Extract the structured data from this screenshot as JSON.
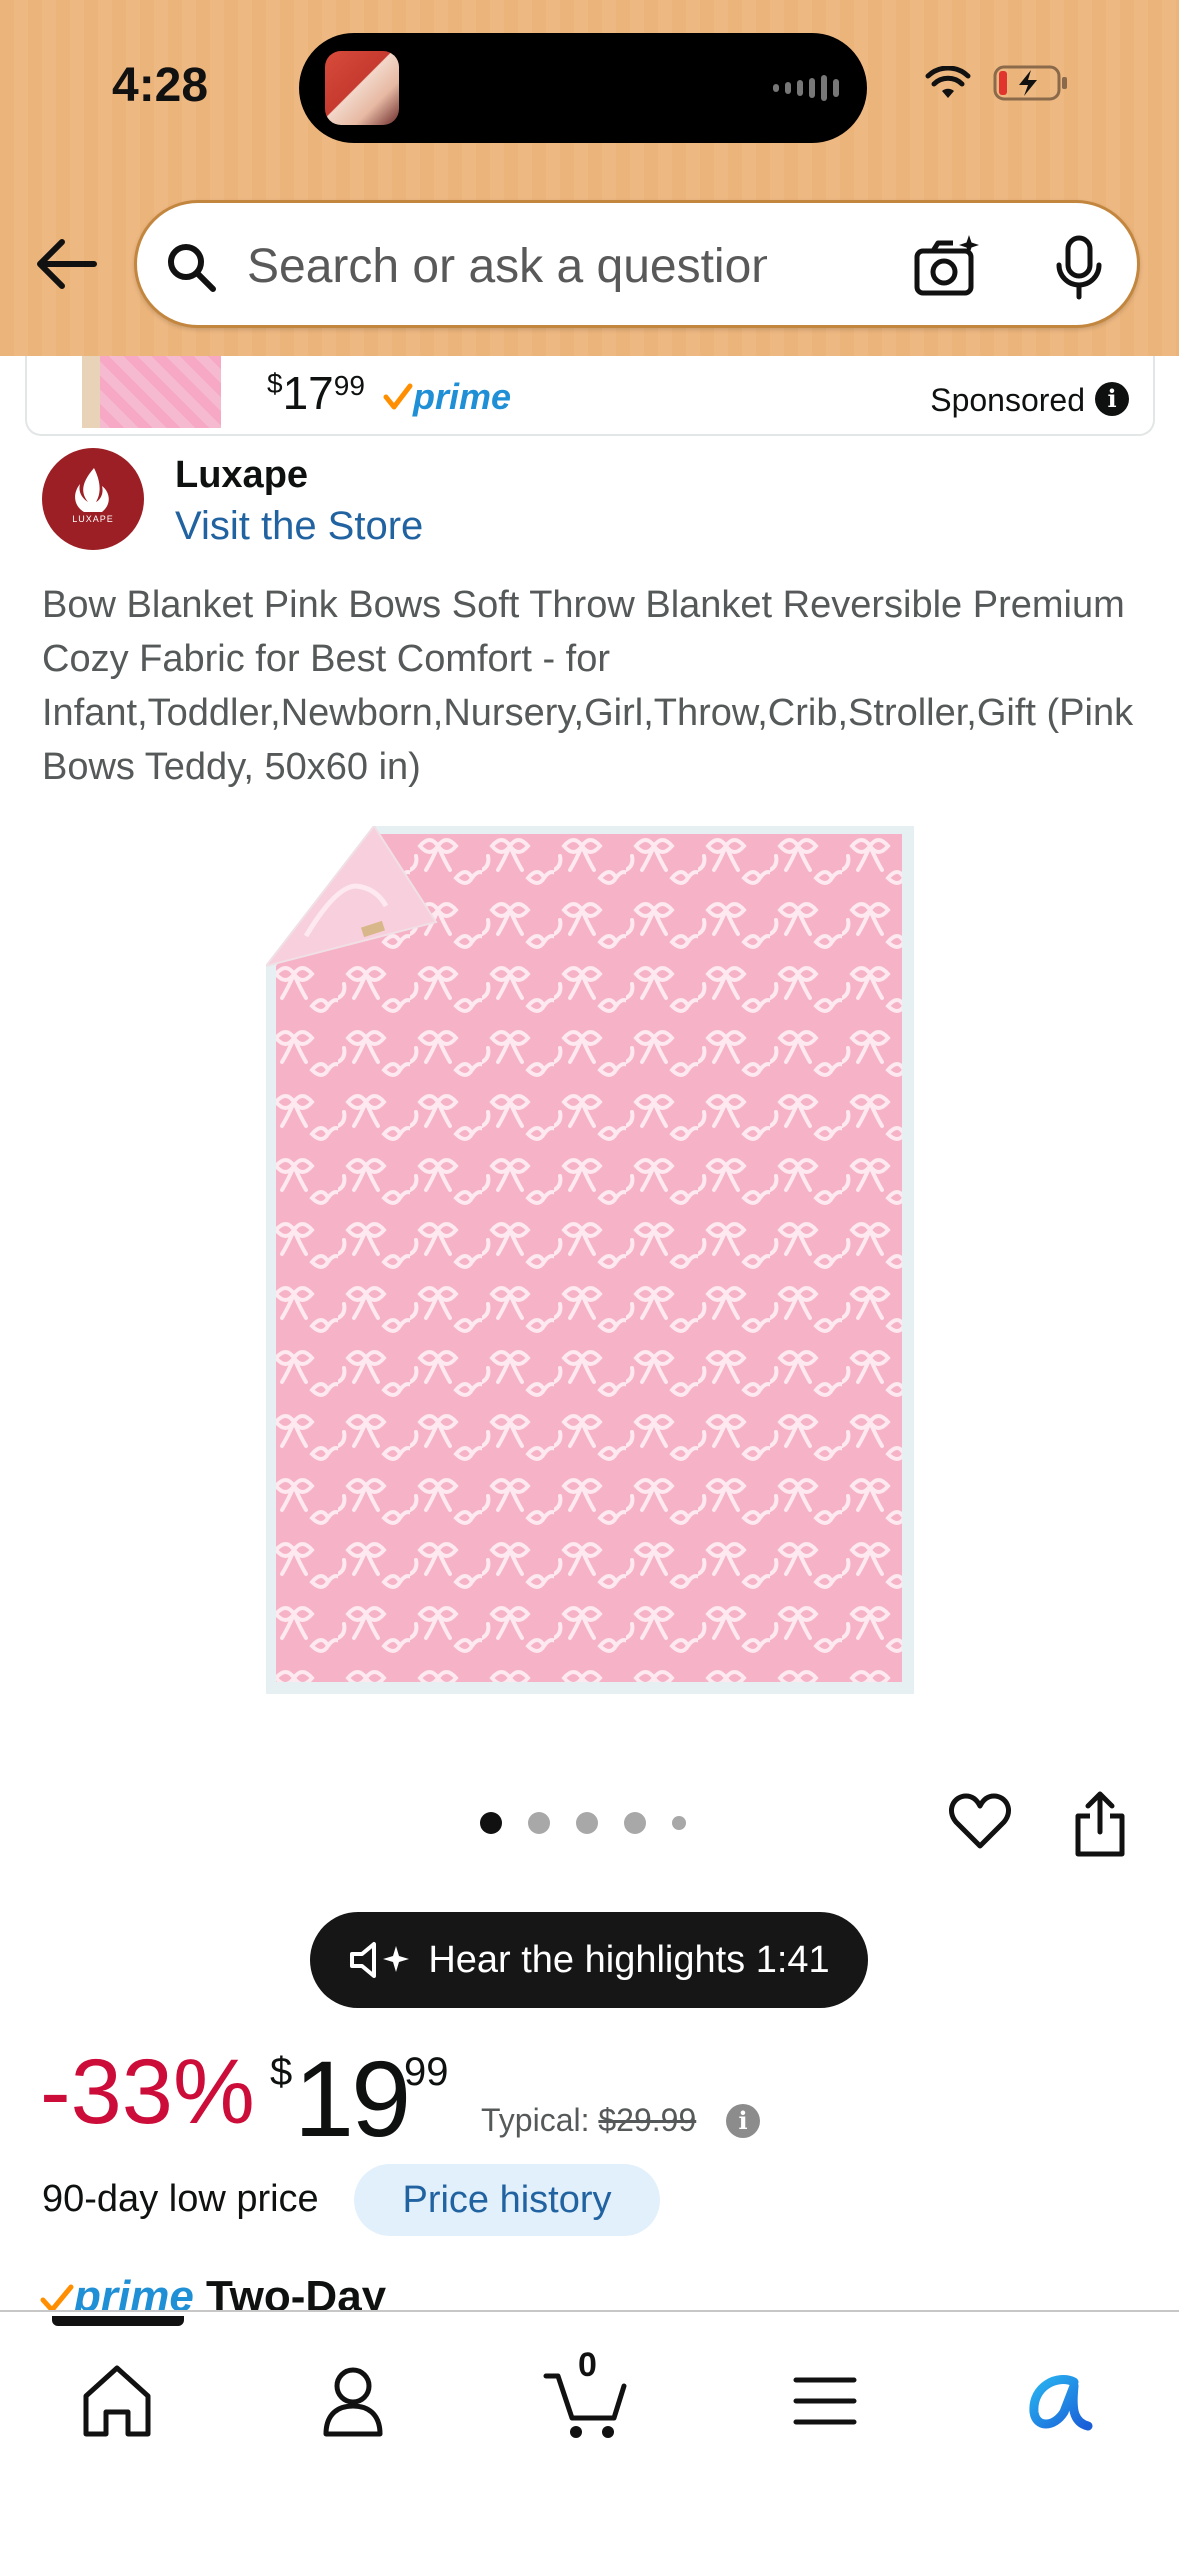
{
  "status_bar": {
    "time": "4:28"
  },
  "search": {
    "placeholder": "Search or ask a question"
  },
  "sponsored": {
    "price_currency": "$",
    "price_whole": "17",
    "price_cents": "99",
    "prime_label": "prime",
    "label": "Sponsored"
  },
  "brand": {
    "name": "Luxape",
    "logo_text": "LUXAPE",
    "store_link": "Visit the Store"
  },
  "product": {
    "title": "Bow Blanket Pink Bows Soft Throw Blanket Reversible Premium Cozy Fabric for Best Comfort - for Infant,Toddler,Newborn,Nursery,Girl,Throw,Crib,Stroller,Gift (Pink Bows Teddy, 50x60 in)",
    "image_count": 5,
    "active_image": 1
  },
  "highlights": {
    "label": "Hear the highlights 1:41"
  },
  "price": {
    "discount": "-33%",
    "currency": "$",
    "whole": "19",
    "cents": "99",
    "typical_label": "Typical: ",
    "typical_value": "$29.99",
    "low_price_label": "90-day low price",
    "price_history": "Price history"
  },
  "delivery": {
    "prime": "prime",
    "text": " Two-Day"
  },
  "bottom_nav": {
    "items": [
      "home",
      "account",
      "cart",
      "menu",
      "rufus"
    ],
    "cart_count": "0"
  },
  "colors": {
    "header_bg": "#ebb47b",
    "discount": "#cc0c39",
    "link": "#2162a1",
    "prime_blue": "#1f8fd6",
    "product_pink": "#f6b3c8"
  }
}
